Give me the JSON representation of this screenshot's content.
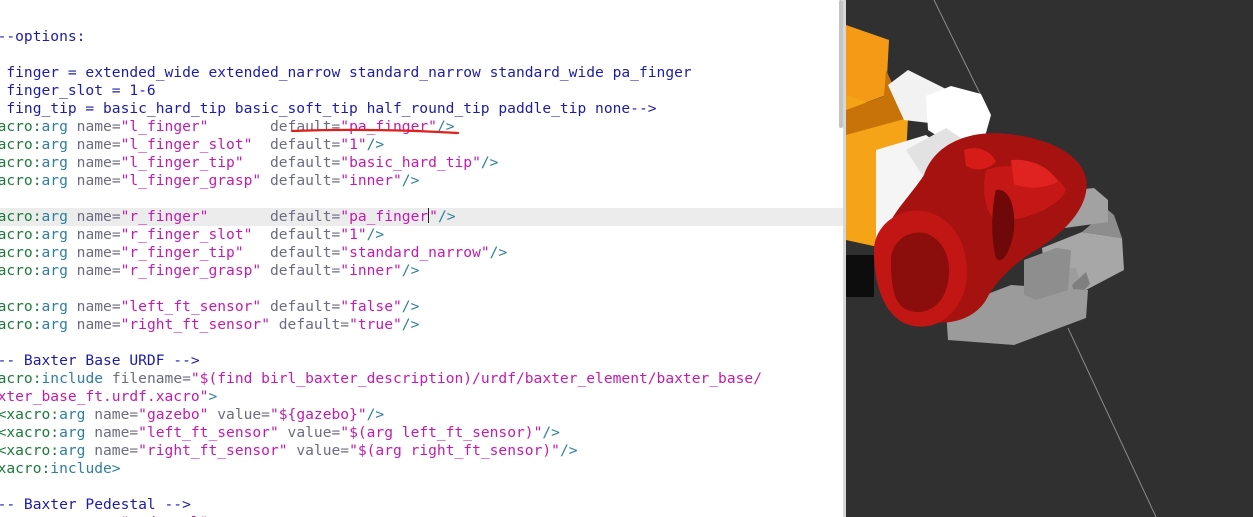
{
  "editor": {
    "lines": [
      {
        "segments": [
          {
            "t": "<!--options:",
            "c": "c"
          }
        ]
      },
      {
        "segments": []
      },
      {
        "segments": [
          {
            "t": "   finger = extended_wide extended_narrow standard_narrow standard_wide pa_finger",
            "c": "c"
          }
        ]
      },
      {
        "segments": [
          {
            "t": "   finger_slot = 1-6",
            "c": "c"
          }
        ]
      },
      {
        "segments": [
          {
            "t": "   fing_tip = basic_hard_tip basic_soft_tip half_round_tip paddle_tip none-->",
            "c": "c"
          }
        ]
      },
      {
        "segments": [
          {
            "t": "<xacro:",
            "c": "k"
          },
          {
            "t": "arg ",
            "c": "t"
          },
          {
            "t": "name=",
            "c": "a"
          },
          {
            "t": "\"l_finger\"",
            "c": "v"
          },
          {
            "t": "       default=",
            "c": "a"
          },
          {
            "t": "\"pa_finger\"",
            "c": "v"
          },
          {
            "t": "/>",
            "c": "t"
          }
        ]
      },
      {
        "segments": [
          {
            "t": "<xacro:",
            "c": "k"
          },
          {
            "t": "arg ",
            "c": "t"
          },
          {
            "t": "name=",
            "c": "a"
          },
          {
            "t": "\"l_finger_slot\"",
            "c": "v"
          },
          {
            "t": "  default=",
            "c": "a"
          },
          {
            "t": "\"1\"",
            "c": "v"
          },
          {
            "t": "/>",
            "c": "t"
          }
        ]
      },
      {
        "segments": [
          {
            "t": "<xacro:",
            "c": "k"
          },
          {
            "t": "arg ",
            "c": "t"
          },
          {
            "t": "name=",
            "c": "a"
          },
          {
            "t": "\"l_finger_tip\"",
            "c": "v"
          },
          {
            "t": "   default=",
            "c": "a"
          },
          {
            "t": "\"basic_hard_tip\"",
            "c": "v"
          },
          {
            "t": "/>",
            "c": "t"
          }
        ]
      },
      {
        "segments": [
          {
            "t": "<xacro:",
            "c": "k"
          },
          {
            "t": "arg ",
            "c": "t"
          },
          {
            "t": "name=",
            "c": "a"
          },
          {
            "t": "\"l_finger_grasp\"",
            "c": "v"
          },
          {
            "t": " default=",
            "c": "a"
          },
          {
            "t": "\"inner\"",
            "c": "v"
          },
          {
            "t": "/>",
            "c": "t"
          }
        ]
      },
      {
        "segments": []
      },
      {
        "current": true,
        "segments": [
          {
            "t": "<xacro:",
            "c": "k"
          },
          {
            "t": "arg ",
            "c": "t"
          },
          {
            "t": "name=",
            "c": "a"
          },
          {
            "t": "\"r_finger\"",
            "c": "v"
          },
          {
            "t": "       default=",
            "c": "a"
          },
          {
            "t": "\"pa_finger",
            "c": "v"
          },
          {
            "cursor": true
          },
          {
            "t": "\"",
            "c": "v"
          },
          {
            "t": "/>",
            "c": "t"
          }
        ]
      },
      {
        "segments": [
          {
            "t": "<xacro:",
            "c": "k"
          },
          {
            "t": "arg ",
            "c": "t"
          },
          {
            "t": "name=",
            "c": "a"
          },
          {
            "t": "\"r_finger_slot\"",
            "c": "v"
          },
          {
            "t": "  default=",
            "c": "a"
          },
          {
            "t": "\"1\"",
            "c": "v"
          },
          {
            "t": "/>",
            "c": "t"
          }
        ]
      },
      {
        "segments": [
          {
            "t": "<xacro:",
            "c": "k"
          },
          {
            "t": "arg ",
            "c": "t"
          },
          {
            "t": "name=",
            "c": "a"
          },
          {
            "t": "\"r_finger_tip\"",
            "c": "v"
          },
          {
            "t": "   default=",
            "c": "a"
          },
          {
            "t": "\"standard_narrow\"",
            "c": "v"
          },
          {
            "t": "/>",
            "c": "t"
          }
        ]
      },
      {
        "segments": [
          {
            "t": "<xacro:",
            "c": "k"
          },
          {
            "t": "arg ",
            "c": "t"
          },
          {
            "t": "name=",
            "c": "a"
          },
          {
            "t": "\"r_finger_grasp\"",
            "c": "v"
          },
          {
            "t": " default=",
            "c": "a"
          },
          {
            "t": "\"inner\"",
            "c": "v"
          },
          {
            "t": "/>",
            "c": "t"
          }
        ]
      },
      {
        "segments": []
      },
      {
        "segments": [
          {
            "t": "<xacro:",
            "c": "k"
          },
          {
            "t": "arg ",
            "c": "t"
          },
          {
            "t": "name=",
            "c": "a"
          },
          {
            "t": "\"left_ft_sensor\"",
            "c": "v"
          },
          {
            "t": " default=",
            "c": "a"
          },
          {
            "t": "\"false\"",
            "c": "v"
          },
          {
            "t": "/>",
            "c": "t"
          }
        ]
      },
      {
        "segments": [
          {
            "t": "<xacro:",
            "c": "k"
          },
          {
            "t": "arg ",
            "c": "t"
          },
          {
            "t": "name=",
            "c": "a"
          },
          {
            "t": "\"right_ft_sensor\"",
            "c": "v"
          },
          {
            "t": " default=",
            "c": "a"
          },
          {
            "t": "\"true\"",
            "c": "v"
          },
          {
            "t": "/>",
            "c": "t"
          }
        ]
      },
      {
        "segments": []
      },
      {
        "segments": [
          {
            "t": "<!-- Baxter Base URDF -->",
            "c": "c"
          }
        ]
      },
      {
        "segments": [
          {
            "t": "<xacro:",
            "c": "k"
          },
          {
            "t": "include ",
            "c": "t"
          },
          {
            "t": "filename=",
            "c": "a"
          },
          {
            "t": "\"$(find birl_baxter_description)/urdf/baxter_element/baxter_base/",
            "c": "v"
          }
        ]
      },
      {
        "segments": [
          {
            "t": "baxter_base_ft.urdf.xacro\"",
            "c": "v"
          },
          {
            "t": ">",
            "c": "t"
          }
        ]
      },
      {
        "segments": [
          {
            "t": "  <xacro:",
            "c": "k"
          },
          {
            "t": "arg ",
            "c": "t"
          },
          {
            "t": "name=",
            "c": "a"
          },
          {
            "t": "\"gazebo\"",
            "c": "v"
          },
          {
            "t": " value=",
            "c": "a"
          },
          {
            "t": "\"${gazebo}\"",
            "c": "v"
          },
          {
            "t": "/>",
            "c": "t"
          }
        ]
      },
      {
        "segments": [
          {
            "t": "  <xacro:",
            "c": "k"
          },
          {
            "t": "arg ",
            "c": "t"
          },
          {
            "t": "name=",
            "c": "a"
          },
          {
            "t": "\"left_ft_sensor\"",
            "c": "v"
          },
          {
            "t": " value=",
            "c": "a"
          },
          {
            "t": "\"$(arg left_ft_sensor)\"",
            "c": "v"
          },
          {
            "t": "/>",
            "c": "t"
          }
        ]
      },
      {
        "segments": [
          {
            "t": "  <xacro:",
            "c": "k"
          },
          {
            "t": "arg ",
            "c": "t"
          },
          {
            "t": "name=",
            "c": "a"
          },
          {
            "t": "\"right_ft_sensor\"",
            "c": "v"
          },
          {
            "t": " value=",
            "c": "a"
          },
          {
            "t": "\"$(arg right_ft_sensor)\"",
            "c": "v"
          },
          {
            "t": "/>",
            "c": "t"
          }
        ]
      },
      {
        "segments": [
          {
            "t": "</xacro:",
            "c": "k"
          },
          {
            "t": "include>",
            "c": "t"
          }
        ]
      },
      {
        "segments": []
      },
      {
        "segments": [
          {
            "t": "<!-- Baxter Pedestal -->",
            "c": "c"
          }
        ]
      },
      {
        "segments": [
          {
            "t": "<xacro:",
            "c": "k"
          },
          {
            "t": "arg ",
            "c": "t"
          },
          {
            "t": "name=",
            "c": "a"
          },
          {
            "t": "\"pedestal\"",
            "c": "v"
          }
        ]
      }
    ]
  },
  "colors": {
    "comment": "#1c1ca8",
    "xacro_prefix": "#1b7b3a",
    "tag": "#2e7f9e",
    "attribute": "#6b6b83",
    "value": "#c41ab1",
    "viewport_background": "#303030",
    "gripper_red": "#a3120f",
    "gripper_orange": "#f39a16",
    "gripper_gray": "#a0a0a0",
    "annotation_underline": "#e0201c"
  },
  "viewport": {
    "scene": "robot-gripper-3d-model"
  }
}
